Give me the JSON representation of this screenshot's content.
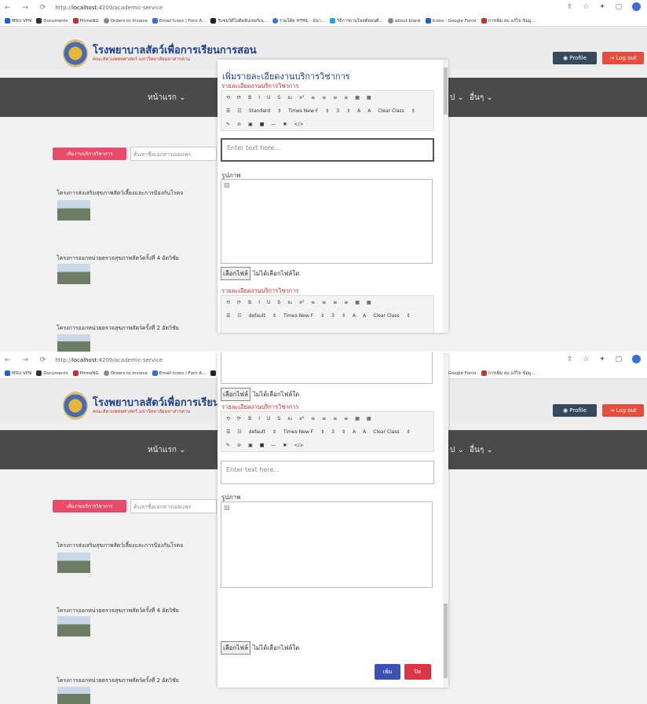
{
  "browser": {
    "url_prefix": "http://",
    "url_host": "localhost",
    "url_rest": ":4200/academic-service",
    "bookmarks": [
      "MSU VPN",
      "Documents",
      "PrimeNG",
      "Orders to Invoice",
      "Email Icons | Font A...",
      "รับชมวิดีโอติดอินเทอร์เน...",
      "รวมโค้ด HTML - ฉันา...",
      "วิธีการถามโพสต์ดอนติ...",
      "about:blank",
      "Icons - Google Fonts",
      "การเพิ่ม ลบ แก้ไข ข้อมู..."
    ]
  },
  "site": {
    "title": "โรงพยาบาลสัตว์เพื่อการเรียนการสอน",
    "subtitle": "คณะสัตวแพทยศาสตร์ มหาวิทยาลัยมหาสารคาม",
    "profile": "Profile",
    "logout": "Log out",
    "nav_home": "หน้าแรก ⌄",
    "nav_other": "อื่นๆ ⌄",
    "nav_caret": "ป ⌄"
  },
  "page": {
    "add_button": "เพิ่มงานบริการวิชาการ",
    "search_placeholder": "ค้นหาชื่อเอกสารเผยแพร่",
    "projects": [
      "โครงการส่งเสริมสุขภาพสัตว์เลี้ยงและการป้องกันโรคจ",
      "โครงการออกหน่วยตรวจสุขภาพสัตว์ครั้งที่ 4 อัตวิชัย",
      "โครงการออกหน่วยตรวจสุขภาพสัตว์ครั้งที่ 2 อัตวิชัย"
    ]
  },
  "modal": {
    "title": "เพิ่มรายละเอียดงานบริการวิชาการ",
    "detail_label": "รายละเอียดงานบริการวิชาการ",
    "toolbar_row1": [
      "⟲",
      "⟳",
      "B",
      "I",
      "U",
      "S",
      "x₂",
      "x²",
      "≡",
      "≡",
      "≡",
      "≡",
      "▦",
      "▦"
    ],
    "toolbar_row2a": [
      "☰",
      "☷",
      "Standard",
      "⇕",
      "Times New F",
      "⇕",
      "3",
      "⇕",
      "A",
      "A",
      "Clear Class",
      "⇕"
    ],
    "toolbar_row2b": [
      "☰",
      "☷",
      "default",
      "⇕",
      "Times New F",
      "⇕",
      "3",
      "⇕",
      "A",
      "A",
      "Clear Class",
      "⇕"
    ],
    "toolbar_row3": [
      "✎",
      "⊘",
      "▣",
      "■",
      "—",
      "✖",
      "</>"
    ],
    "editor_placeholder": "Enter text here...",
    "image_label": "รูปภาพ",
    "choose_file": "เลือกไฟล์",
    "no_file": "ไม่ได้เลือกไฟล์ใด",
    "add": "เพิ่ม",
    "close": "ปิด"
  }
}
